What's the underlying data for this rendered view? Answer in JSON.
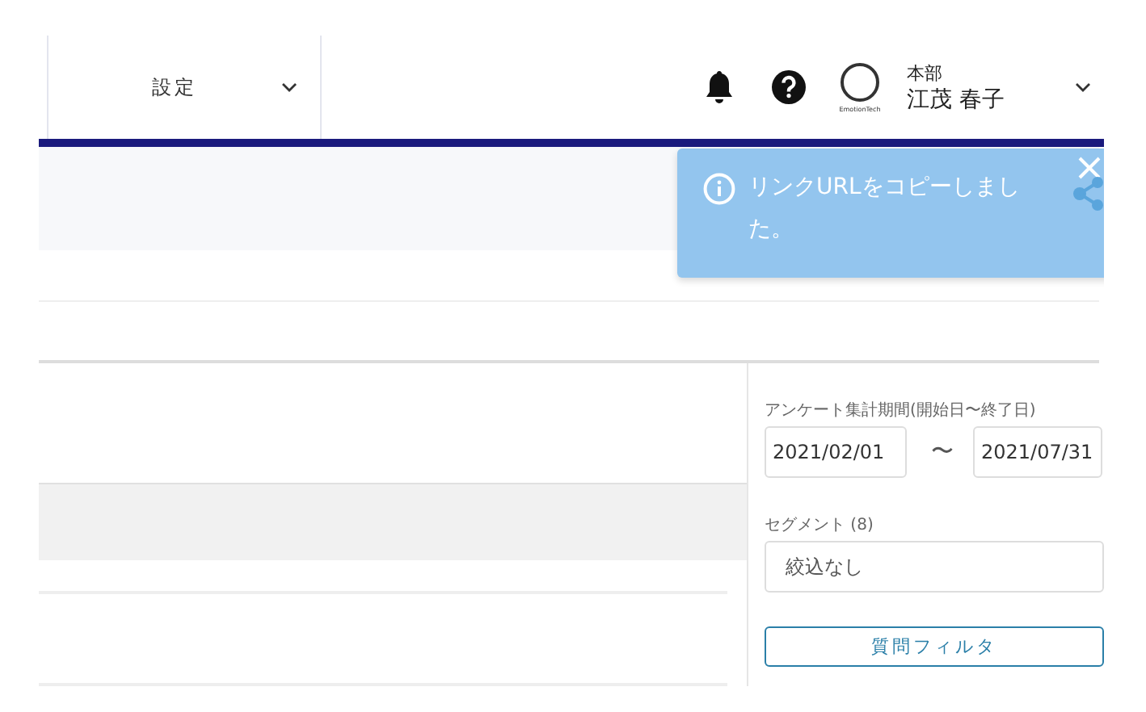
{
  "header": {
    "menu": {
      "label": "設定",
      "expanded": false
    },
    "logo_text": "EmotionTech",
    "user": {
      "department": "本部",
      "name": "江茂 春子"
    }
  },
  "toast": {
    "message": "リンクURLをコピーしました。"
  },
  "sidebar": {
    "period": {
      "label": "アンケート集計期間(開始日〜終了日)",
      "start": "2021/02/01",
      "separator": "〜",
      "end": "2021/07/31"
    },
    "segment": {
      "label": "セグメント (8)",
      "value": "絞込なし"
    },
    "filter_button": "質問フィルタ"
  }
}
